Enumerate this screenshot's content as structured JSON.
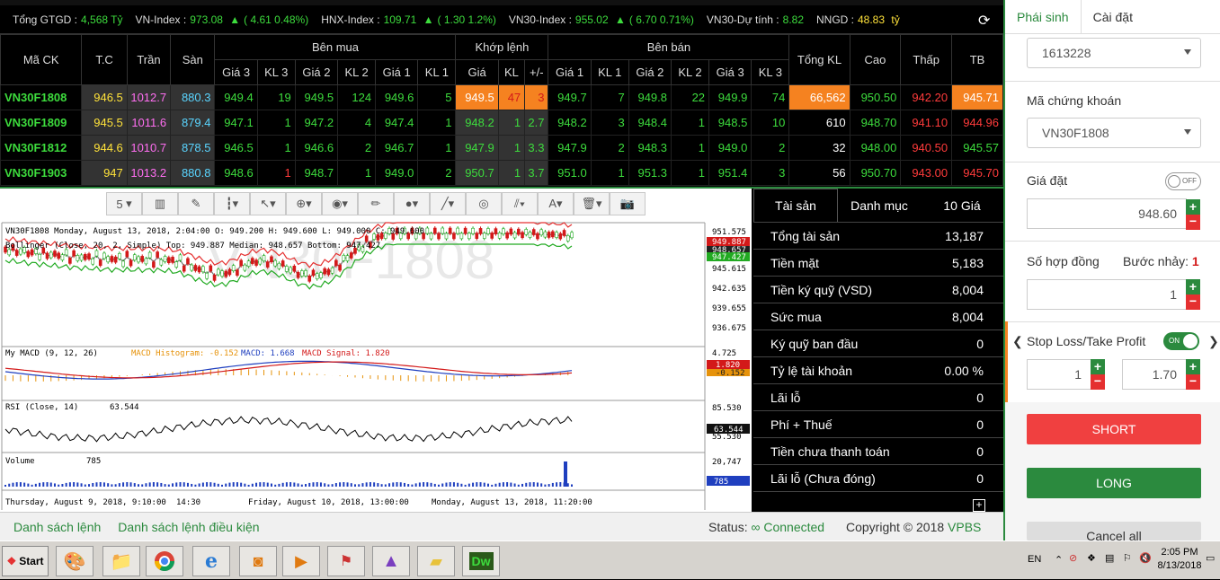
{
  "ticker": [
    {
      "label": "Tổng GTGD :",
      "value": "4,568 Tỷ",
      "change": ""
    },
    {
      "label": "VN-Index :",
      "value": "973.08",
      "change": "( 4.61 0.48%)"
    },
    {
      "label": "HNX-Index :",
      "value": "109.71",
      "change": "( 1.30 1.2%)"
    },
    {
      "label": "VN30-Index :",
      "value": "955.02",
      "change": "( 6.70 0.71%)"
    },
    {
      "label": "VN30-Dự tính :",
      "value": "8.82",
      "change": ""
    },
    {
      "label": "NNGD :",
      "value": "48.83",
      "unit": "tỷ"
    }
  ],
  "board": {
    "headers": {
      "symbol": "Mã CK",
      "ref": "T.C",
      "ceil": "Trần",
      "floor": "Sàn",
      "buy": "Bên mua",
      "match": "Khớp lệnh",
      "sell": "Bên bán",
      "total": "Tổng KL",
      "high": "Cao",
      "low": "Thấp",
      "avg": "TB"
    },
    "subheaders": [
      "Giá 3",
      "KL 3",
      "Giá 2",
      "KL 2",
      "Giá 1",
      "KL 1",
      "Giá",
      "KL",
      "+/-",
      "Giá 1",
      "KL 1",
      "Giá 2",
      "KL 2",
      "Giá 3",
      "KL 3"
    ],
    "rows": [
      {
        "sym": "VN30F1808",
        "ref": "946.5",
        "ceil": "1012.7",
        "floor": "880.3",
        "b3": "949.4",
        "bk3": "19",
        "b2": "949.5",
        "bk2": "124",
        "b1": "949.6",
        "bk1": "5",
        "mp": "949.5",
        "mk": "47",
        "chg": "3",
        "s1": "949.7",
        "sk1": "7",
        "s2": "949.8",
        "sk2": "22",
        "s3": "949.9",
        "sk3": "74",
        "total": "66,562",
        "high": "950.50",
        "low": "942.20",
        "avg": "945.71"
      },
      {
        "sym": "VN30F1809",
        "ref": "945.5",
        "ceil": "1011.6",
        "floor": "879.4",
        "b3": "947.1",
        "bk3": "1",
        "b2": "947.2",
        "bk2": "4",
        "b1": "947.4",
        "bk1": "1",
        "mp": "948.2",
        "mk": "1",
        "chg": "2.7",
        "s1": "948.2",
        "sk1": "3",
        "s2": "948.4",
        "sk2": "1",
        "s3": "948.5",
        "sk3": "10",
        "total": "610",
        "high": "948.70",
        "low": "941.10",
        "avg": "944.96"
      },
      {
        "sym": "VN30F1812",
        "ref": "944.6",
        "ceil": "1010.7",
        "floor": "878.5",
        "b3": "946.5",
        "bk3": "1",
        "b2": "946.6",
        "bk2": "2",
        "b1": "946.7",
        "bk1": "1",
        "mp": "947.9",
        "mk": "1",
        "chg": "3.3",
        "s1": "947.9",
        "sk1": "2",
        "s2": "948.3",
        "sk2": "1",
        "s3": "949.0",
        "sk3": "2",
        "total": "32",
        "high": "948.00",
        "low": "940.50",
        "avg": "945.57"
      },
      {
        "sym": "VN30F1903",
        "ref": "947",
        "ceil": "1013.2",
        "floor": "880.8",
        "b3": "948.6",
        "bk3": "1",
        "b2": "948.7",
        "bk2": "1",
        "b1": "949.0",
        "bk1": "2",
        "mp": "950.7",
        "mk": "1",
        "chg": "3.7",
        "s1": "951.0",
        "sk1": "1",
        "s2": "951.3",
        "sk2": "1",
        "s3": "951.4",
        "sk3": "3",
        "total": "56",
        "high": "950.70",
        "low": "943.00",
        "avg": "945.70"
      }
    ]
  },
  "chart": {
    "toolbar_interval": "5",
    "header": "VN30F1808   Monday, August 13, 2018, 2:04:00      O: 949.200  H: 949.600  L: 949.000  C: 949.600",
    "bollinger": "Bollinger (Close, 20, 2, Simple)   Top: 949.887  Median: 948.657  Bottom: 947.427",
    "watermark": "VN30F1808",
    "price_axis": [
      "951.575",
      "945.615",
      "942.635",
      "939.655",
      "936.675"
    ],
    "price_tags": [
      "949.887",
      "948.657",
      "947.427"
    ],
    "macd_label": "My MACD  (9, 12, 26)",
    "macd_hist": "MACD Histogram: -0.152",
    "macd_val": "MACD: 1.668",
    "macd_sig": "MACD Signal: 1.820",
    "macd_axis": [
      "4.725"
    ],
    "macd_tags": [
      "1.820",
      "-0.152"
    ],
    "rsi_label": "RSI  (Close, 14)",
    "rsi_val": "63.544",
    "rsi_axis": [
      "85.530",
      "55.530"
    ],
    "rsi_tag": "63.544",
    "vol_label": "Volume",
    "vol_val": "785",
    "vol_axis": [
      "20,747"
    ],
    "vol_tag": "785",
    "time_labels": [
      "Thursday, August 9, 2018, 9:10:00",
      "14:30",
      "Friday, August 10, 2018, 13:00:00",
      "Monday, August 13, 2018, 11:20:00"
    ]
  },
  "account": {
    "tabs": [
      "Tài sản",
      "Danh mục",
      "10 Giá"
    ],
    "rows": [
      {
        "label": "Tổng tài sản",
        "value": "13,187"
      },
      {
        "label": "Tiền mặt",
        "value": "5,183"
      },
      {
        "label": "Tiền ký quỹ (VSD)",
        "value": "8,004"
      },
      {
        "label": "Sức mua",
        "value": "8,004"
      },
      {
        "label": "Ký quỹ ban đầu",
        "value": "0"
      },
      {
        "label": "Tỷ lệ tài khoản",
        "value": "0.00 %"
      },
      {
        "label": "Lãi lỗ",
        "value": "0"
      },
      {
        "label": "Phí + Thuế",
        "value": "0"
      },
      {
        "label": "Tiền chưa thanh toán",
        "value": "0"
      },
      {
        "label": "Lãi lỗ (Chưa đóng)",
        "value": "0"
      }
    ]
  },
  "bottombar": {
    "orders": "Danh sách lệnh",
    "cond_orders": "Danh sách lệnh điều kiện",
    "status_label": "Status:",
    "status_value": "Connected",
    "copyright": "Copyright © 2018",
    "brand": "VPBS"
  },
  "order": {
    "tabs": [
      "Phái sinh",
      "Cài đặt"
    ],
    "account": "1613228",
    "symbol_label": "Mã chứng khoán",
    "symbol": "VN30F1808",
    "price_label": "Giá đặt",
    "price_toggle": "OFF",
    "price": "948.60",
    "qty_label": "Số hợp đồng",
    "step_label": "Bước nhảy:",
    "step": "1",
    "qty": "1",
    "sltp_label": "Stop Loss/Take Profit",
    "sltp_toggle": "ON",
    "sl": "1",
    "tp": "1.70",
    "short": "SHORT",
    "long": "LONG",
    "cancel_all": "Cancel all"
  },
  "taskbar": {
    "start": "Start",
    "lang": "EN",
    "time": "2:05 PM",
    "date": "8/13/2018"
  }
}
